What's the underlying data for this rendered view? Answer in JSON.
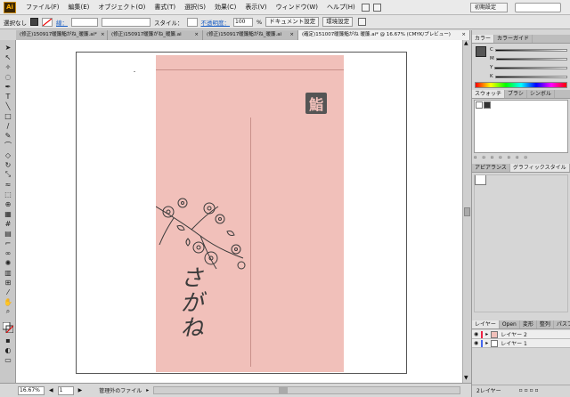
{
  "menubar": {
    "logo": "Ai",
    "items": [
      "ファイル(F)",
      "編集(E)",
      "オブジェクト(O)",
      "書式(T)",
      "選択(S)",
      "効果(C)",
      "表示(V)",
      "ウィンドウ(W)",
      "ヘルプ(H)"
    ],
    "workspace": "初期設定"
  },
  "control": {
    "selection": "選択なし",
    "stroke_label": "線：",
    "style_label": "スタイル：",
    "opacity_label": "不透明度：",
    "opacity_value": "100",
    "opacity_unit": "%",
    "doc_settings": "ドキュメント設定",
    "prefs": "環境設定"
  },
  "tabs": [
    {
      "label": "(修正)150917暖簾鮨がね_暖簾.ai*",
      "active": false
    },
    {
      "label": "(修正)150917暖簾がね_暖簾.ai",
      "active": false
    },
    {
      "label": "(修正)150917暖簾鮨がね_暖簾.ai",
      "active": false
    },
    {
      "label": "(確定)151007暖簾鮨がね 暖簾.ai* @ 16.67% (CMYK/プレビュー)",
      "active": true
    }
  ],
  "document": {
    "emblem": "鮨",
    "vertical_text": "さがね"
  },
  "status": {
    "zoom": "16.67%",
    "page": "1",
    "info": "管理外のファイル"
  },
  "panels": {
    "color_tabs": [
      "カラー",
      "カラーガイド"
    ],
    "sliders": [
      "C",
      "M",
      "Y",
      "K"
    ],
    "swatch_tabs": [
      "スウォッチ",
      "ブラシ",
      "シンボル"
    ],
    "appearance_tabs": [
      "アピアランス",
      "グラフィックスタイル"
    ],
    "layer_tabs": [
      "レイヤー",
      "Open",
      "変形",
      "整列",
      "パスフ"
    ],
    "layers": [
      "レイヤー 2",
      "レイヤー 1"
    ],
    "layer_count": "2レイヤー"
  },
  "colors": {
    "noren": "#f1c0ba",
    "ink": "#333333"
  }
}
